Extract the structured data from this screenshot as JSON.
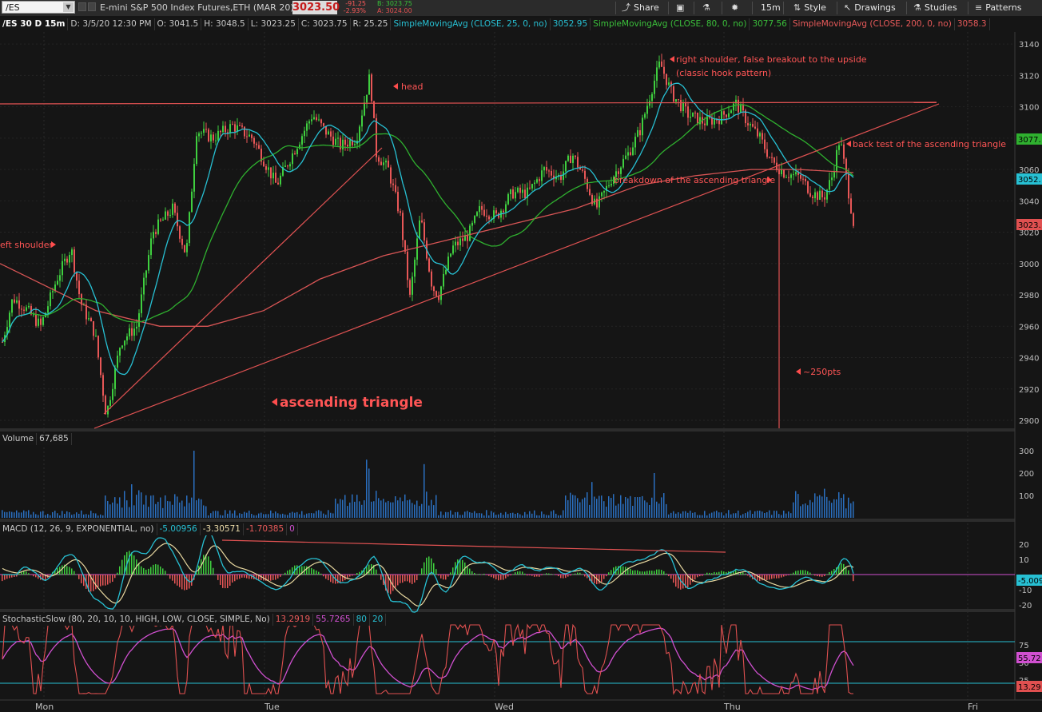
{
  "toolbar": {
    "symbol": "/ES",
    "description": "E-mini S&P 500 Index Futures,ETH (MAR 20)",
    "last": "3023.50",
    "net_change": "-91.25",
    "pct_change": "-2.93%",
    "bid": "B: 3023.75",
    "ask": "A: 3024.00",
    "share_label": "Share",
    "timeframe_label": "15m",
    "style_label": "Style",
    "drawings_label": "Drawings",
    "studies_label": "Studies",
    "patterns_label": "Patterns"
  },
  "price_header": {
    "symbol": "/ES 30 D 15m",
    "date": "D: 3/5/20 12:30 PM",
    "open": "O: 3041.5",
    "high": "H: 3048.5",
    "low": "L: 3023.25",
    "close": "C: 3023.75",
    "range": "R: 25.25",
    "sma25_label": "SimpleMovingAvg (CLOSE, 25, 0, no)",
    "sma25_value": "3052.95",
    "sma80_label": "SimpleMovingAvg (CLOSE, 80, 0, no)",
    "sma80_value": "3077.56",
    "sma200_label": "SimpleMovingAvg (CLOSE, 200, 0, no)",
    "sma200_value": "3058.3"
  },
  "price_axis": {
    "ticks": [
      "3140",
      "3120",
      "3100",
      "3080",
      "3060",
      "3040",
      "3020",
      "3000",
      "2980",
      "2960",
      "2940",
      "2920",
      "2900"
    ],
    "badge_sma80": "3077.",
    "badge_sma25": "3052.",
    "badge_last": "3023."
  },
  "annotations": {
    "left_shoulder": "eft shoulder",
    "head": "head",
    "right_shoulder_1": "right shoulder, false breakout to the upside",
    "right_shoulder_2": "(classic hook pattern)",
    "back_test": "back test of the ascending triangle",
    "breakdown": "breakdown of the ascending triangle",
    "target": "~250pts",
    "pattern": "ascending triangle"
  },
  "volume": {
    "label": "Volume",
    "value": "67,685",
    "ticks": [
      "300",
      "200",
      "100"
    ]
  },
  "macd": {
    "label": "MACD (12, 26, 9, EXPONENTIAL, no)",
    "value": "-5.00956",
    "avg": "-3.30571",
    "diff": "-1.70385",
    "zero": "0",
    "ticks": [
      "20",
      "10",
      "-10",
      "-20"
    ],
    "badge": "-5.009"
  },
  "stoch": {
    "label": "StochasticSlow (80, 20, 10, 10, HIGH, LOW, CLOSE, SIMPLE, No)",
    "k": "13.2919",
    "d": "55.7265",
    "ob": "80",
    "os": "20",
    "ticks": [
      "75",
      "50",
      "25"
    ],
    "badge_d": "55.72",
    "badge_k": "13.29"
  },
  "time_axis": {
    "labels": [
      "Mon",
      "Tue",
      "Wed",
      "Thu",
      "Fri"
    ]
  },
  "colors": {
    "up": "#3fcf3f",
    "down": "#e85757",
    "sma25": "#2bc4d6",
    "sma80": "#34b534",
    "sma200": "#e06060",
    "annotation": "#ff4d4d"
  }
}
